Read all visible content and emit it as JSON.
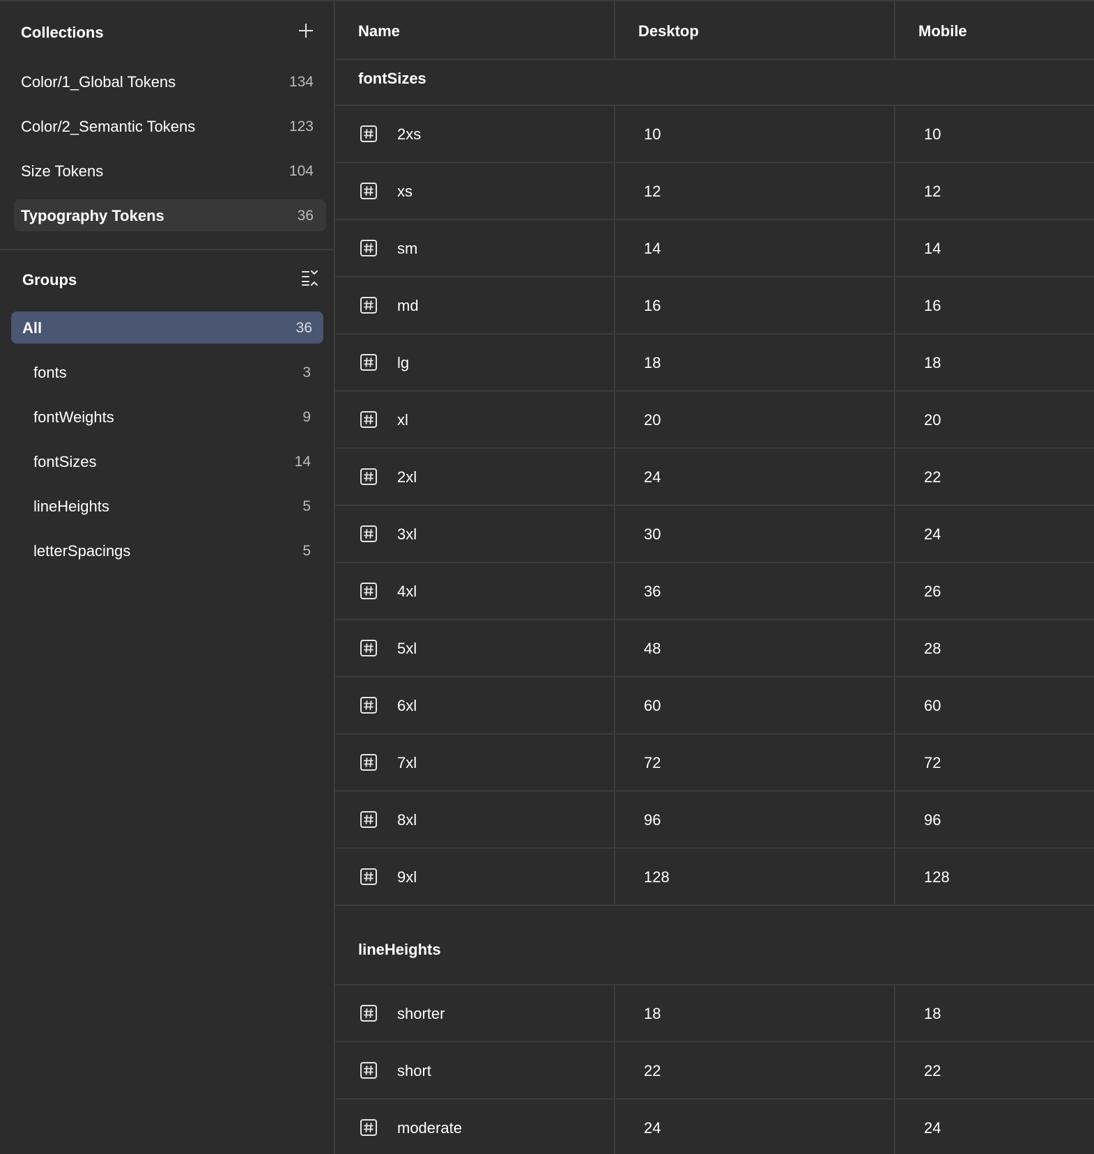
{
  "sidebar": {
    "collections_title": "Collections",
    "collections": [
      {
        "label": "Color/1_Global Tokens",
        "count": "134"
      },
      {
        "label": "Color/2_Semantic Tokens",
        "count": "123"
      },
      {
        "label": "Size Tokens",
        "count": "104"
      },
      {
        "label": "Typography Tokens",
        "count": "36",
        "selected": true
      }
    ],
    "groups_title": "Groups",
    "groups": [
      {
        "label": "All",
        "count": "36",
        "selected": true
      },
      {
        "label": "fonts",
        "count": "3"
      },
      {
        "label": "fontWeights",
        "count": "9"
      },
      {
        "label": "fontSizes",
        "count": "14"
      },
      {
        "label": "lineHeights",
        "count": "5"
      },
      {
        "label": "letterSpacings",
        "count": "5"
      }
    ]
  },
  "table": {
    "columns": [
      "Name",
      "Desktop",
      "Mobile"
    ],
    "sections": [
      {
        "title": "fontSizes",
        "rows": [
          {
            "name": "2xs",
            "desktop": "10",
            "mobile": "10"
          },
          {
            "name": "xs",
            "desktop": "12",
            "mobile": "12"
          },
          {
            "name": "sm",
            "desktop": "14",
            "mobile": "14"
          },
          {
            "name": "md",
            "desktop": "16",
            "mobile": "16"
          },
          {
            "name": "lg",
            "desktop": "18",
            "mobile": "18"
          },
          {
            "name": "xl",
            "desktop": "20",
            "mobile": "20"
          },
          {
            "name": "2xl",
            "desktop": "24",
            "mobile": "22"
          },
          {
            "name": "3xl",
            "desktop": "30",
            "mobile": "24"
          },
          {
            "name": "4xl",
            "desktop": "36",
            "mobile": "26"
          },
          {
            "name": "5xl",
            "desktop": "48",
            "mobile": "28"
          },
          {
            "name": "6xl",
            "desktop": "60",
            "mobile": "60"
          },
          {
            "name": "7xl",
            "desktop": "72",
            "mobile": "72"
          },
          {
            "name": "8xl",
            "desktop": "96",
            "mobile": "96"
          },
          {
            "name": "9xl",
            "desktop": "128",
            "mobile": "128"
          }
        ]
      },
      {
        "title": "lineHeights",
        "rows": [
          {
            "name": "shorter",
            "desktop": "18",
            "mobile": "18"
          },
          {
            "name": "short",
            "desktop": "22",
            "mobile": "22"
          },
          {
            "name": "moderate",
            "desktop": "24",
            "mobile": "24"
          }
        ]
      }
    ]
  },
  "icons": {
    "add": "plus-icon",
    "filter": "list-collapse-icon",
    "number_variable": "number-variable-icon"
  },
  "colors": {
    "background": "#2c2c2c",
    "border": "#3c3c3c",
    "selected_group": "#4a5672",
    "selected_collection": "#383838"
  }
}
